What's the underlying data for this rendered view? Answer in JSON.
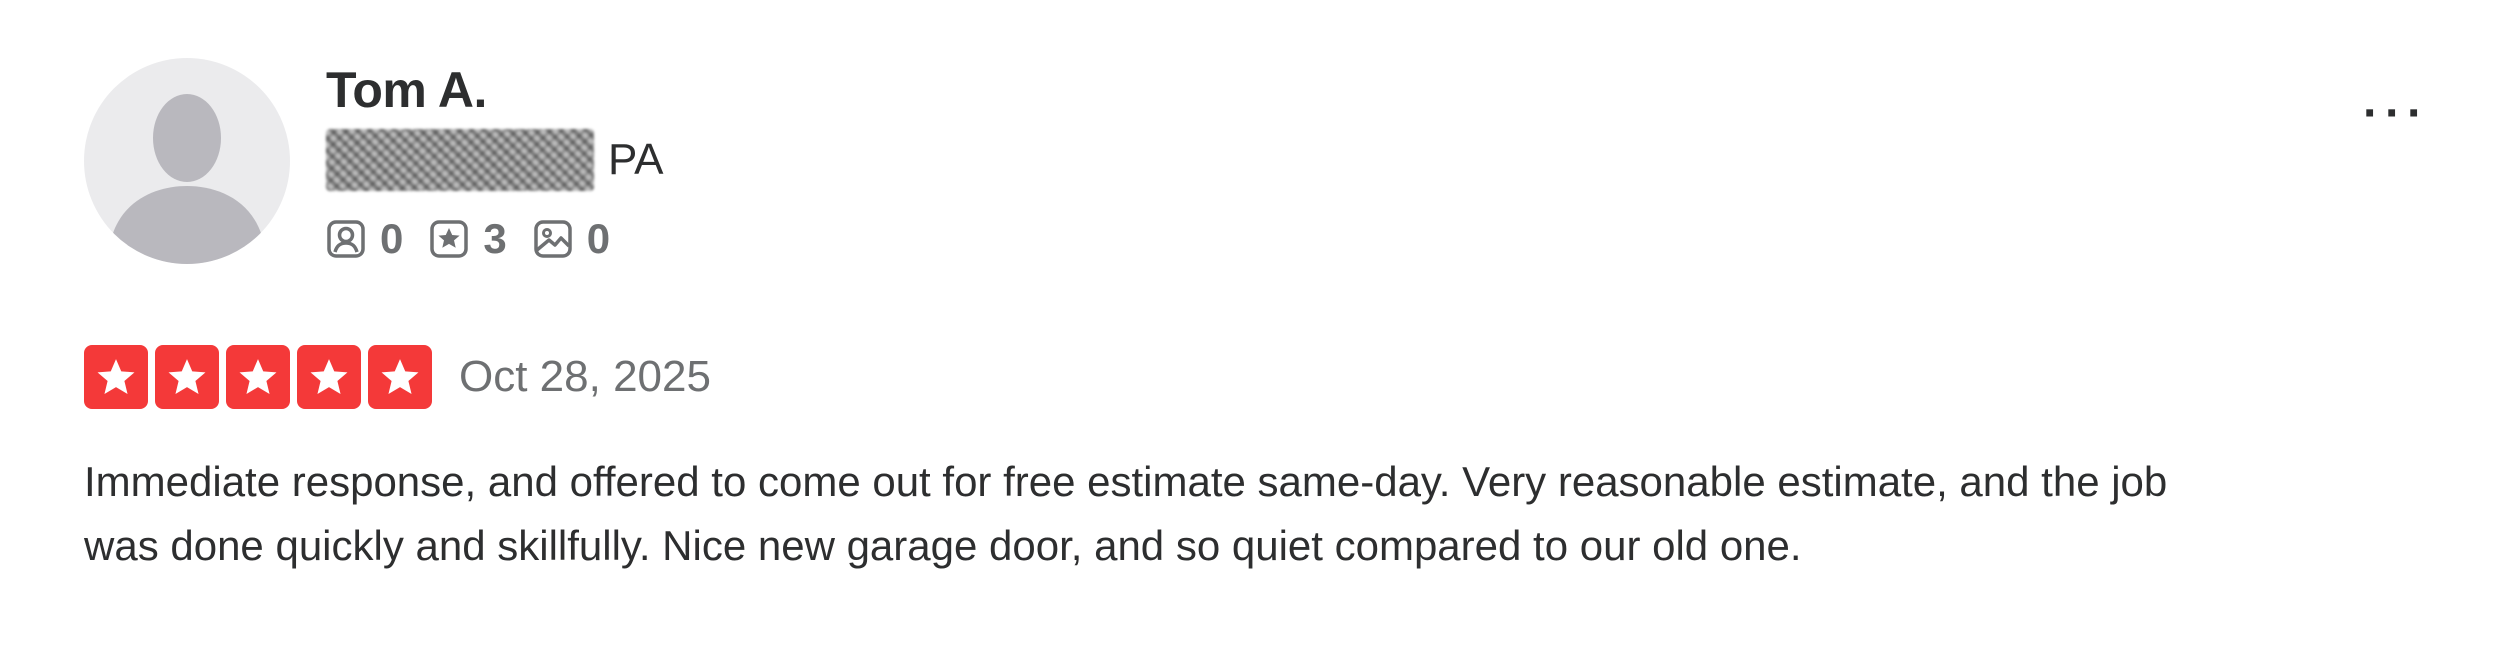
{
  "reviewer": {
    "name": "Tom A.",
    "location_state": "PA",
    "stats": {
      "friends": "0",
      "reviews": "3",
      "photos": "0"
    }
  },
  "icons": {
    "avatar": "default-user-silhouette-icon",
    "friends": "friends-icon",
    "reviews": "star-badge-icon",
    "photos": "photo-icon",
    "more": "more-options-icon",
    "star": "star-icon"
  },
  "review": {
    "rating": 5,
    "rating_max": 5,
    "date": "Oct 28, 2025",
    "text": "Immediate response, and offered to come out for free estimate same-day. Very reasonable estimate, and the job was done quickly and skillfully. Nice new garage door, and so quiet compared to our old one."
  },
  "colors": {
    "star_background": "#f43939",
    "text_primary": "#2d2e2f",
    "text_secondary": "#6e7072",
    "avatar_background": "#ebebed",
    "avatar_silhouette": "#b9b8be"
  }
}
